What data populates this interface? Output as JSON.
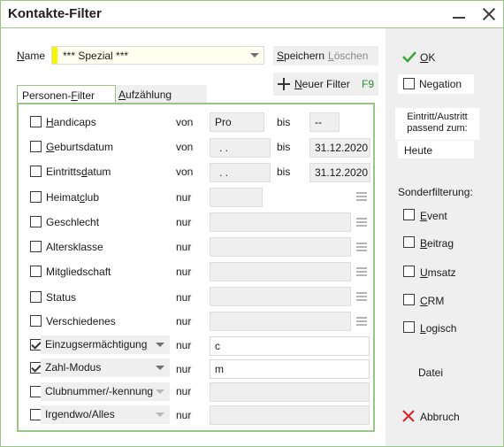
{
  "window": {
    "title": "Kontakte-Filter"
  },
  "name_field": {
    "label": "Name",
    "value": "*** Spezial ***"
  },
  "buttons": {
    "save": "Speichern",
    "delete": "Löschen",
    "new_filter": "Neuer Filter",
    "new_filter_shortcut": "F9",
    "ok": "OK",
    "cancel": "Abbruch",
    "file": "Datei"
  },
  "tabs": [
    "Personen-Filter",
    "Aufzählung"
  ],
  "filters": [
    {
      "label": "Handicaps",
      "op": "von",
      "from": "Pro",
      "to_label": "bis",
      "to": "--"
    },
    {
      "label": "Geburtsdatum",
      "op": "von",
      "from": " .  .",
      "to_label": "bis",
      "to": "31.12.2020"
    },
    {
      "label": "Eintrittsdatum",
      "op": "von",
      "from": " .  .",
      "to_label": "bis",
      "to": "31.12.2020"
    },
    {
      "label": "Heimatclub",
      "op": "nur",
      "value": ""
    },
    {
      "label": "Geschlecht",
      "op": "nur",
      "value": ""
    },
    {
      "label": "Altersklasse",
      "op": "nur",
      "value": ""
    },
    {
      "label": "Mitgliedschaft",
      "op": "nur",
      "value": ""
    },
    {
      "label": "Status",
      "op": "nur",
      "value": ""
    },
    {
      "label": "Verschiedenes",
      "op": "nur",
      "value": ""
    }
  ],
  "combo_filters": [
    {
      "label": "Einzugsermächtigung",
      "checked": true,
      "op": "nur",
      "value": "c"
    },
    {
      "label": "Zahl-Modus",
      "checked": true,
      "op": "nur",
      "value": "m"
    },
    {
      "label": "Clubnummer/-kennung",
      "checked": false,
      "op": "nur",
      "value": ""
    },
    {
      "label": "Irgendwo/Alles",
      "checked": false,
      "op": "nur",
      "value": ""
    }
  ],
  "right_panel": {
    "negation": "Negation",
    "entry_exit_label": "Eintritt/Austritt passend zum:",
    "entry_exit_value": "Heute",
    "special_label": "Sonderfilterung:",
    "special_options": [
      "Event",
      "Beitrag",
      "Umsatz",
      "CRM",
      "Logisch"
    ]
  },
  "colors": {
    "accent_green": "#9bc488",
    "ok_check": "#3aa63a",
    "cancel_x": "#d22b2b",
    "name_marker": "#f5f500"
  }
}
